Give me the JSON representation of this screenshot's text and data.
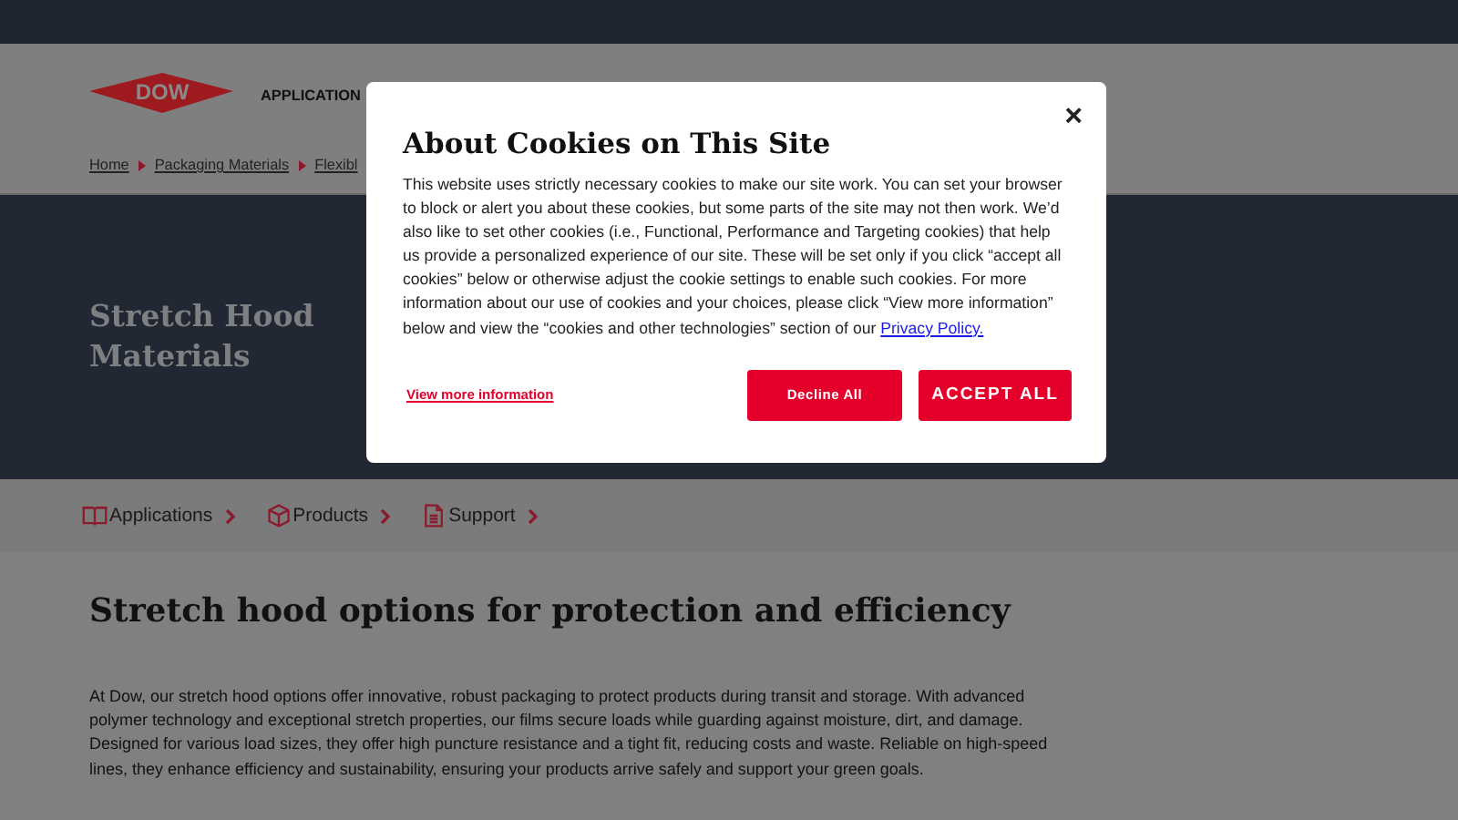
{
  "header": {
    "logo": "DOW",
    "nav": [
      "APPLICATION"
    ]
  },
  "breadcrumb": [
    "Home",
    "Packaging Materials",
    "Flexibl"
  ],
  "hero": {
    "title_lines": [
      "Stretch Hood",
      "Materials"
    ]
  },
  "section_nav": [
    {
      "label": "Applications",
      "kind": "book"
    },
    {
      "label": "Products",
      "kind": "box"
    },
    {
      "label": "Support",
      "kind": "document"
    }
  ],
  "content": {
    "heading": "Stretch hood options for protection and efficiency",
    "paragraph": "At Dow, our stretch hood options offer innovative, robust packaging to protect products during transit and storage. With advanced polymer technology and exceptional stretch properties, our films secure loads while guarding against moisture, dirt, and damage. Designed for various load sizes, they offer high puncture resistance and a tight fit, reducing costs and waste. Reliable on high-speed lines, they enhance efficiency and sustainability, ensuring your products arrive safely and support your green goals."
  },
  "cookie_dialog": {
    "close": "×",
    "title": "About Cookies on This Site",
    "text": "This website uses strictly necessary cookies to make our site work. You can set your browser to block or alert you about these cookies, but some parts of the site may not then work. We’d also like to set other cookies (i.e., Functional, Performance and Targeting cookies) that help us provide a personalized experience of our site. These will be set only if you click “accept all cookies” below or otherwise adjust the cookie settings to enable such cookies. For more information about our use of cookies and your choices, please click “View more information” below and view the “cookies and other technologies” section of our",
    "link": "Privacy Policy.",
    "more_link": "View more information",
    "buttons": [
      "Decline All",
      "ACCEPT ALL"
    ]
  }
}
